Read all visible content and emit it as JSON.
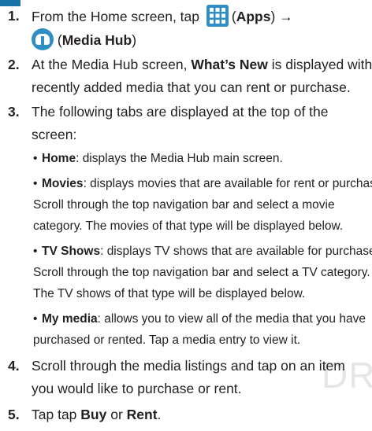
{
  "steps": [
    {
      "num": "1.",
      "line1_pre": "From the Home screen, tap ",
      "apps_label": "Apps",
      "arrow": " →",
      "line2_label": "Media Hub"
    },
    {
      "num": "2.",
      "line1_pre": "At the Media Hub screen, ",
      "line1_bold": "What’s New",
      "line1_post": " is displayed with",
      "line2": "recently added media that you can rent or purchase."
    },
    {
      "num": "3.",
      "line1": "The following tabs are displayed at the top of the",
      "line2": "screen:"
    },
    {
      "num": "4.",
      "line1": "Scroll through the media listings and tap on an item",
      "line2": "you would like to purchase or rent."
    },
    {
      "num": "5.",
      "line1_pre": "Tap tap ",
      "buy": "Buy",
      "or": " or ",
      "rent": "Rent",
      "end": "."
    }
  ],
  "tabs": [
    {
      "name": "Home",
      "lines": [
        ": displays the Media Hub main screen."
      ]
    },
    {
      "name": "Movies",
      "lines": [
        ": displays movies that are available for rent or purchase.",
        "Scroll through the top navigation bar and select a movie",
        "category. The movies of that type will be displayed below."
      ]
    },
    {
      "name": "TV Shows",
      "lines": [
        ": displays TV shows that are available for purchase.",
        "Scroll through the top navigation bar and select a TV category.",
        "The TV shows of that type will be displayed below."
      ]
    },
    {
      "name": "My media",
      "lines": [
        ": allows you to view all of the media that you have",
        "purchased or rented. Tap a media entry to view it."
      ]
    }
  ],
  "watermark": "DR",
  "colors": {
    "accent": "#2f8fc5",
    "text": "#231f20"
  }
}
